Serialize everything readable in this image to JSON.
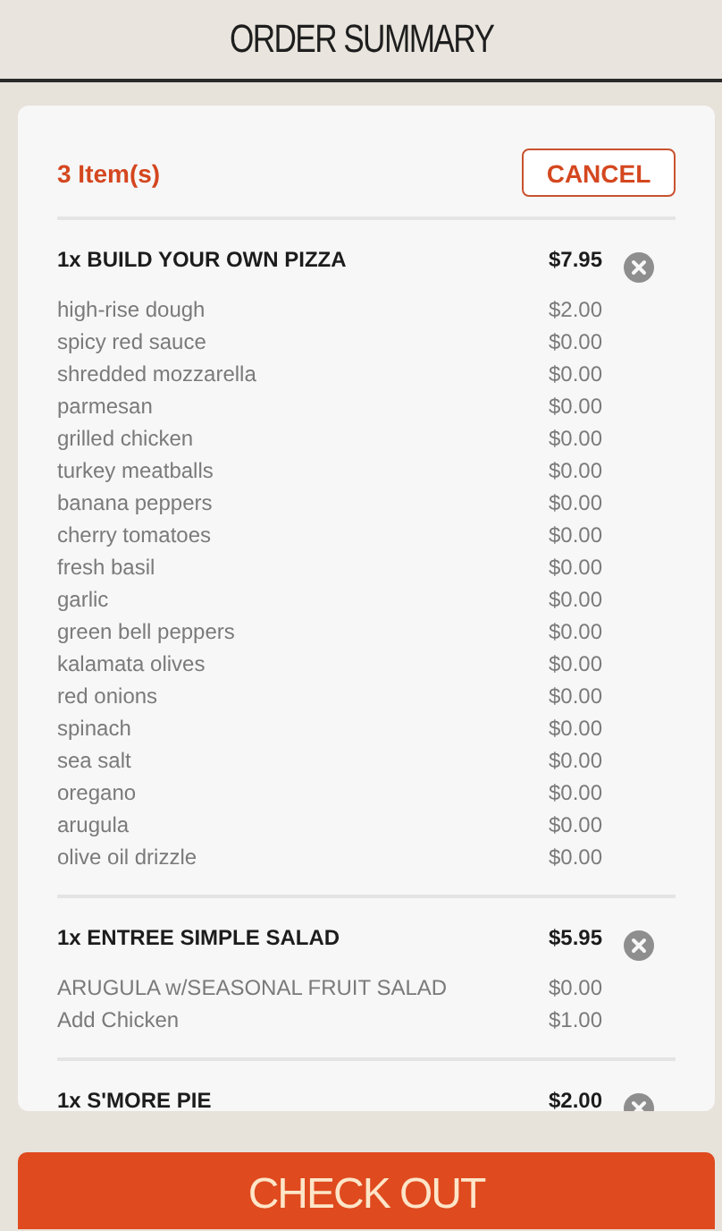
{
  "header": {
    "title": "ORDER SUMMARY"
  },
  "order": {
    "item_count": "3 Item(s)",
    "cancel_label": "CANCEL",
    "items": [
      {
        "title": "1x BUILD YOUR OWN PIZZA",
        "price": "$7.95",
        "modifiers": [
          {
            "name": "high-rise dough",
            "price": "$2.00"
          },
          {
            "name": "spicy red sauce",
            "price": "$0.00"
          },
          {
            "name": "shredded mozzarella",
            "price": "$0.00"
          },
          {
            "name": "parmesan",
            "price": "$0.00"
          },
          {
            "name": "grilled chicken",
            "price": "$0.00"
          },
          {
            "name": "turkey meatballs",
            "price": "$0.00"
          },
          {
            "name": "banana peppers",
            "price": "$0.00"
          },
          {
            "name": "cherry tomatoes",
            "price": "$0.00"
          },
          {
            "name": "fresh basil",
            "price": "$0.00"
          },
          {
            "name": "garlic",
            "price": "$0.00"
          },
          {
            "name": "green bell peppers",
            "price": "$0.00"
          },
          {
            "name": "kalamata olives",
            "price": "$0.00"
          },
          {
            "name": "red onions",
            "price": "$0.00"
          },
          {
            "name": "spinach",
            "price": "$0.00"
          },
          {
            "name": "sea salt",
            "price": "$0.00"
          },
          {
            "name": "oregano",
            "price": "$0.00"
          },
          {
            "name": "arugula",
            "price": "$0.00"
          },
          {
            "name": "olive oil drizzle",
            "price": "$0.00"
          }
        ]
      },
      {
        "title": "1x ENTREE SIMPLE SALAD",
        "price": "$5.95",
        "modifiers": [
          {
            "name": "ARUGULA w/SEASONAL FRUIT SALAD",
            "price": "$0.00"
          },
          {
            "name": "Add Chicken",
            "price": "$1.00"
          }
        ]
      },
      {
        "title": "1x S'MORE PIE",
        "price": "$2.00"
      }
    ]
  },
  "checkout_label": "CHECK OUT"
}
